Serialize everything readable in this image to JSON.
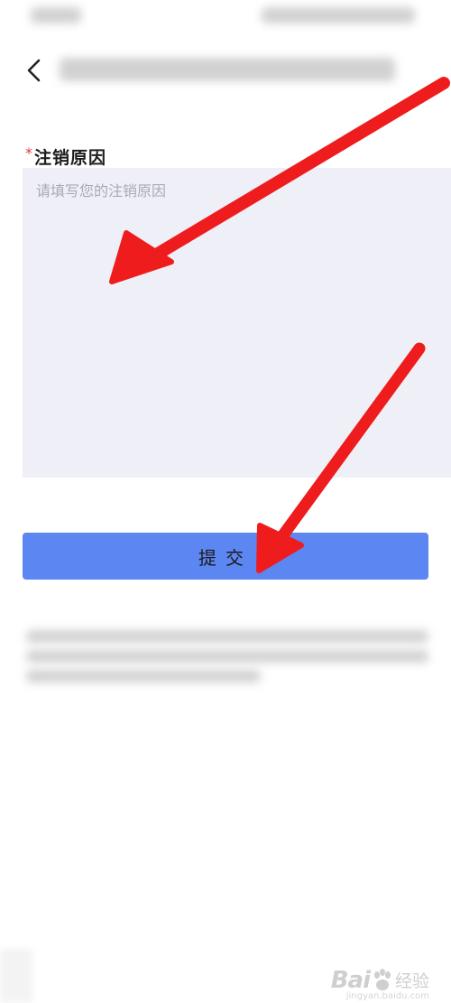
{
  "form": {
    "reason_label": "注销原因",
    "required_mark": "*",
    "reason_placeholder": "请填写您的注销原因",
    "reason_value": ""
  },
  "submit": {
    "label": "提交"
  },
  "watermark": {
    "brand": "Bai",
    "brand_cn": "经验",
    "domain": "jingyan.baidu.com"
  },
  "icons": {
    "back": "back-chevron-icon",
    "paw": "paw-icon"
  },
  "colors": {
    "accent": "#5c86f2",
    "input_bg": "#efeff8",
    "required": "#e53935",
    "annotation_arrow": "#ee1c1c"
  }
}
